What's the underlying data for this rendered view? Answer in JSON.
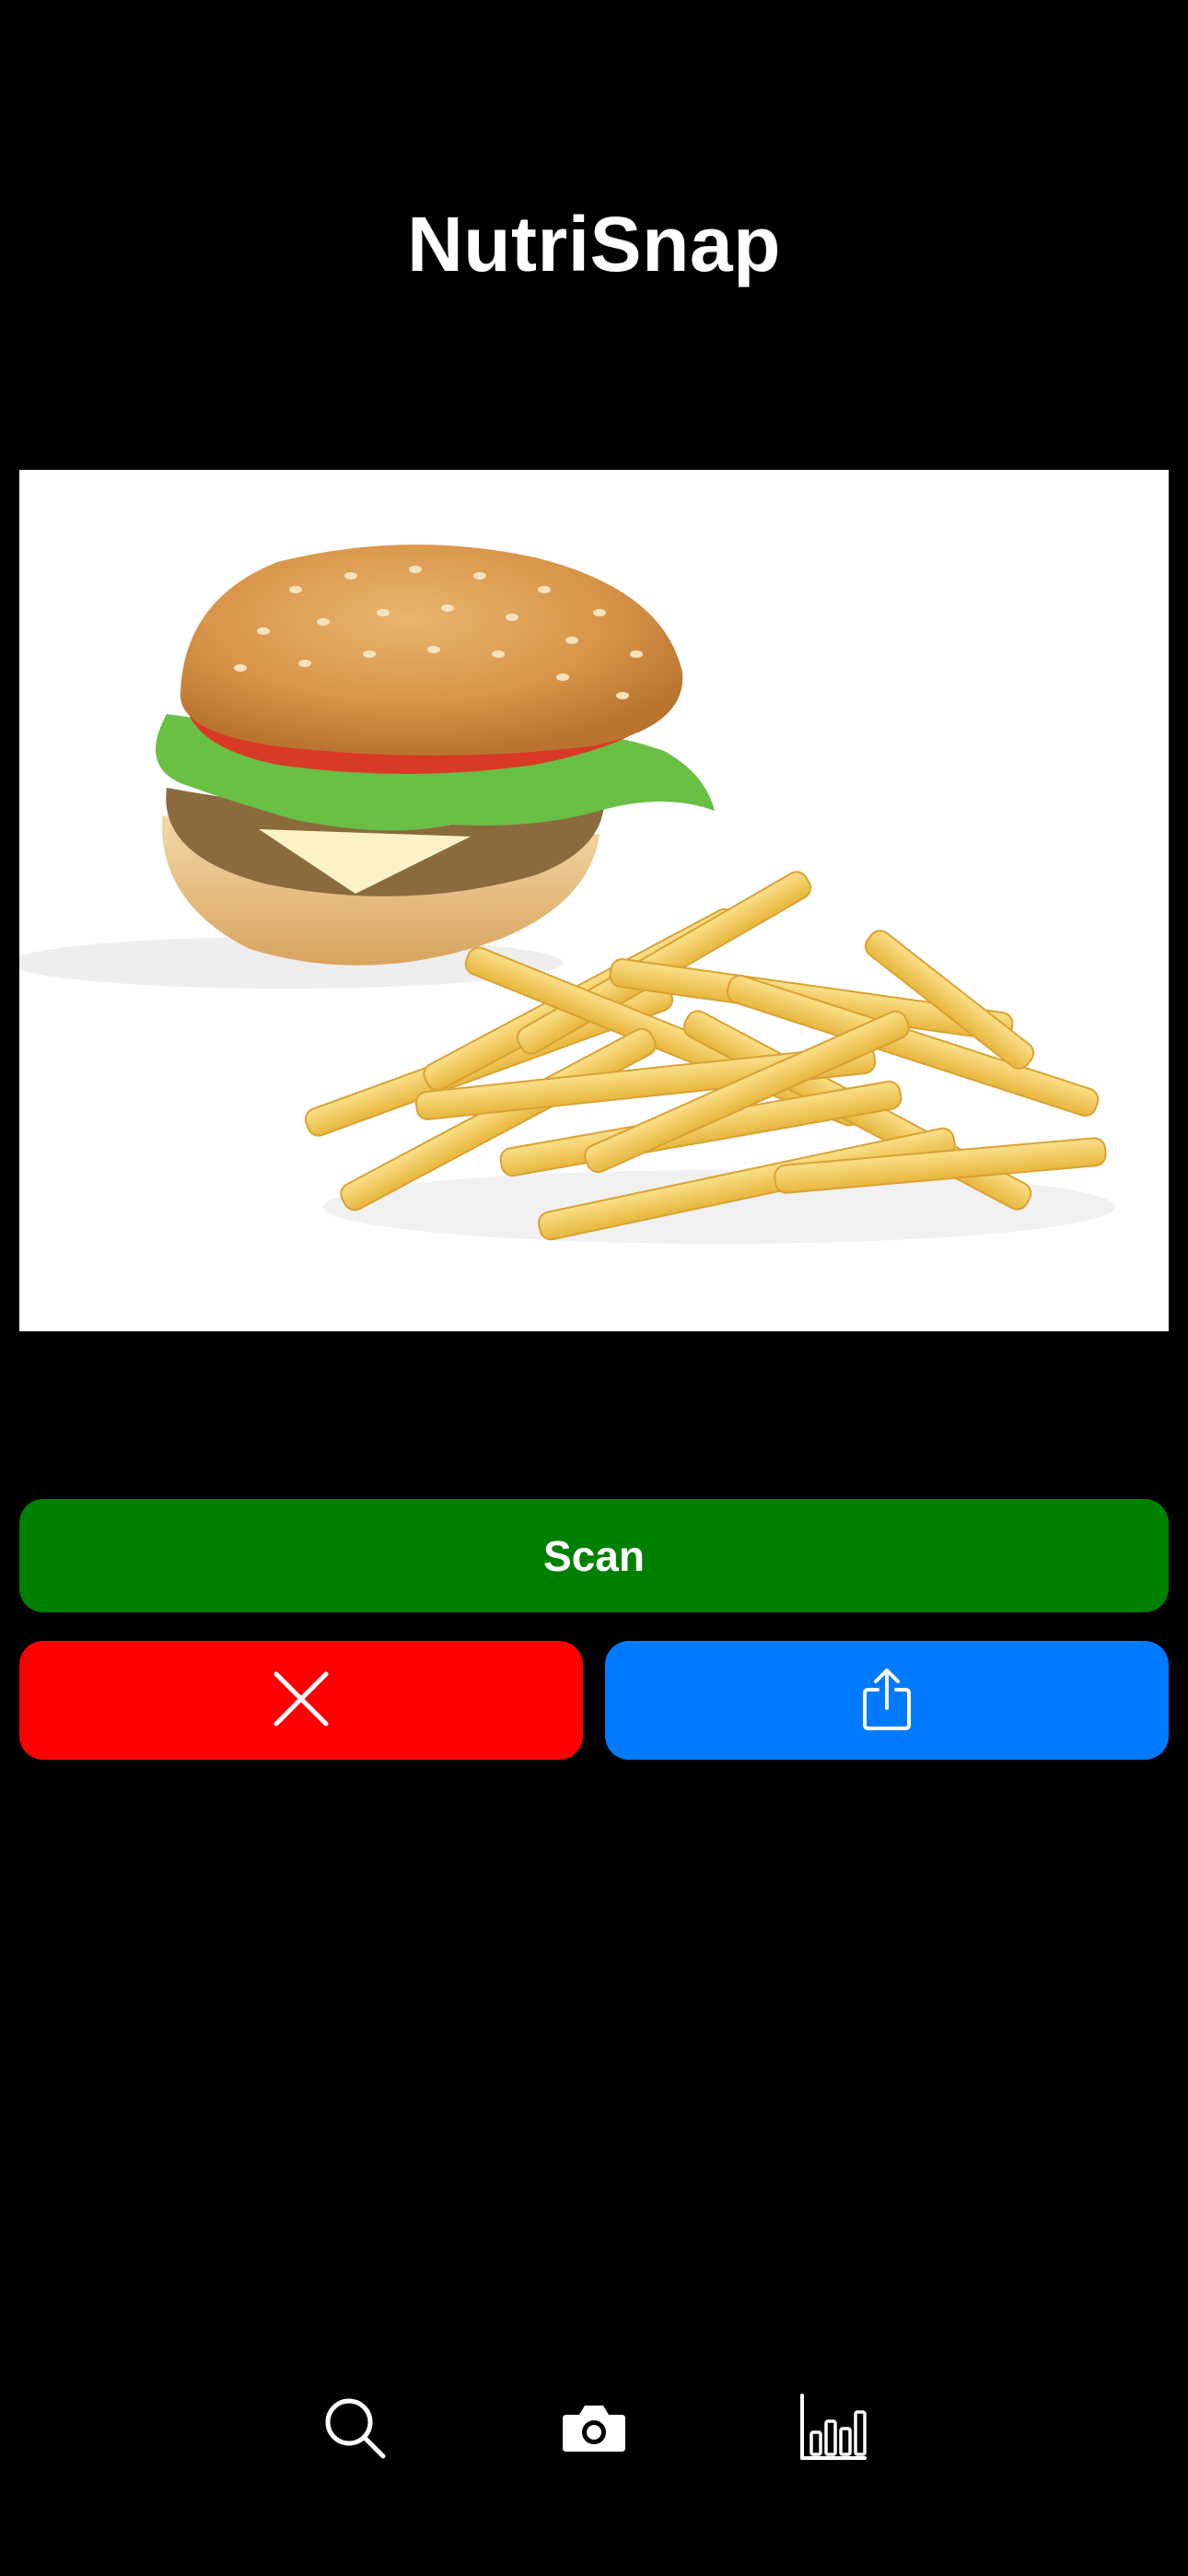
{
  "app": {
    "title": "NutriSnap"
  },
  "photo": {
    "subject": "burger-and-fries-photo"
  },
  "actions": {
    "scan_label": "Scan",
    "cancel_icon": "close-icon",
    "share_icon": "share-icon"
  },
  "tab_bar": {
    "items": [
      {
        "icon": "search-icon"
      },
      {
        "icon": "camera-icon"
      },
      {
        "icon": "bar-chart-icon"
      }
    ]
  },
  "colors": {
    "background": "#000000",
    "scan": "#008000",
    "cancel": "#ff0000",
    "share": "#007aff",
    "text": "#ffffff"
  }
}
